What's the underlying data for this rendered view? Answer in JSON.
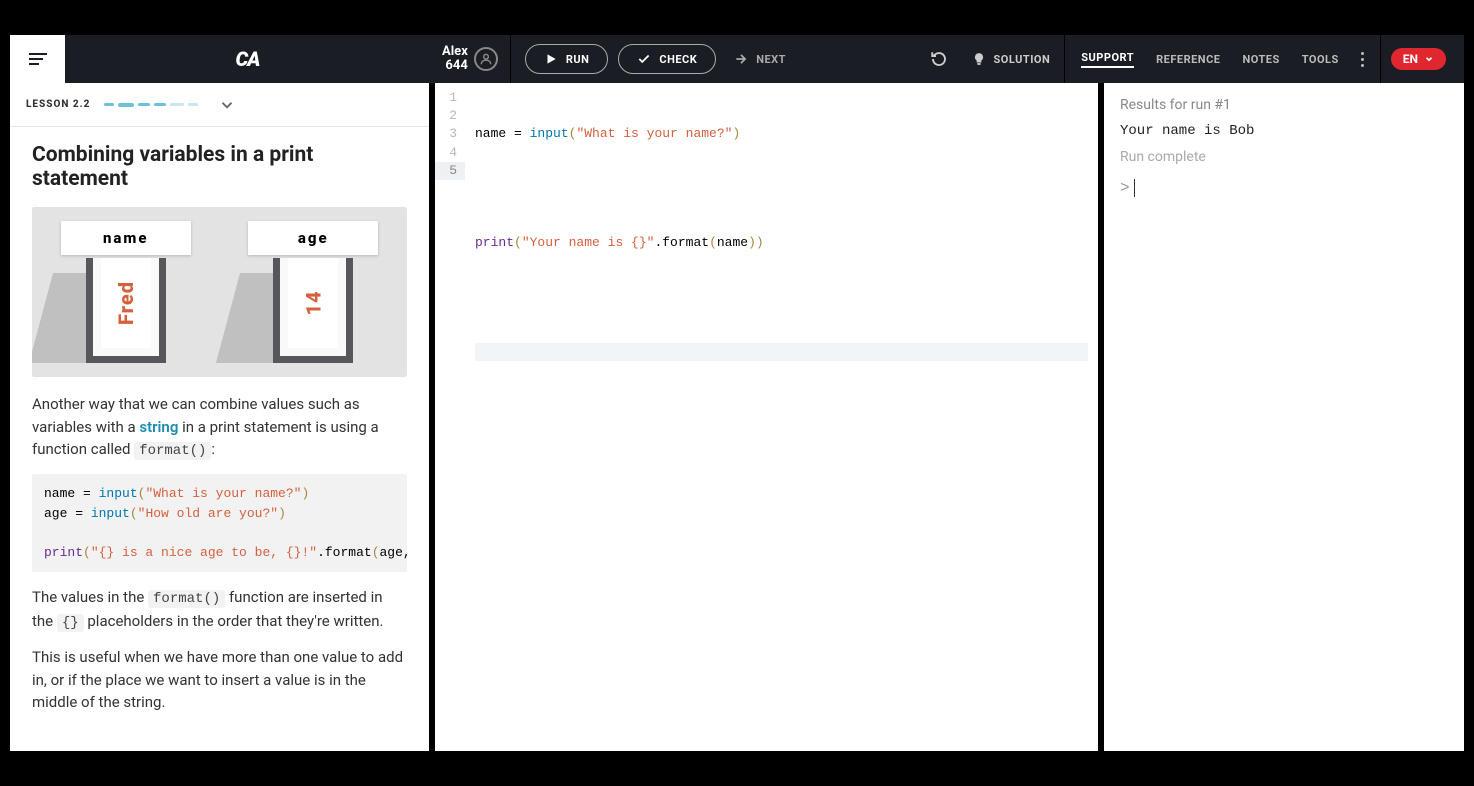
{
  "user": {
    "name": "Alex",
    "points": "644"
  },
  "actions": {
    "run": "RUN",
    "check": "CHECK",
    "next": "NEXT",
    "solution": "SOLUTION"
  },
  "topnav": {
    "support": "SUPPORT",
    "reference": "REFERENCE",
    "notes": "NOTES",
    "tools": "TOOLS"
  },
  "lang": "EN",
  "lesson": {
    "label": "LESSON 2.2",
    "title": "Combining variables in a print statement",
    "illustration": {
      "box1": {
        "label": "name",
        "value": "Fred"
      },
      "box2": {
        "label": "age",
        "value": "14"
      }
    },
    "para1_pre": "Another way that we can combine values such as variables with a ",
    "para1_link": "string",
    "para1_post": " in a print statement is using a function called ",
    "para1_code": "format()",
    "example_code": {
      "l1_a": "name = ",
      "l1_b": "input",
      "l1_c": "(",
      "l1_d": "\"What is your name?\"",
      "l1_e": ")",
      "l2_a": "age = ",
      "l2_b": "input",
      "l2_c": "(",
      "l2_d": "\"How old are you?\"",
      "l2_e": ")",
      "l3_a": "print",
      "l3_b": "(",
      "l3_c": "\"{} is a nice age to be, {}!\"",
      "l3_d": ".format",
      "l3_e": "(",
      "l3_f": "age, name",
      "l3_g": "))"
    },
    "para2_a": "The values in the ",
    "para2_code1": "format()",
    "para2_b": " function are inserted in the ",
    "para2_code2": "{}",
    "para2_c": " placeholders in the order that they're written.",
    "para3": "This is useful when we have more than one value to add in, or if the place we want to insert a value is in the middle of the string."
  },
  "editor": {
    "line_nums": [
      "1",
      "2",
      "3",
      "4",
      "5"
    ],
    "l1": {
      "a": "name = ",
      "b": "input",
      "c": "(",
      "d": "\"What is your name?\"",
      "e": ")"
    },
    "l3": {
      "a": "print",
      "b": "(",
      "c": "\"Your name is {}\"",
      "d": ".format",
      "e": "(",
      "f": "name",
      "g": "))"
    }
  },
  "output": {
    "title": "Results for run #1",
    "line1": "Your name is Bob",
    "complete": "Run complete",
    "prompt": ">"
  }
}
